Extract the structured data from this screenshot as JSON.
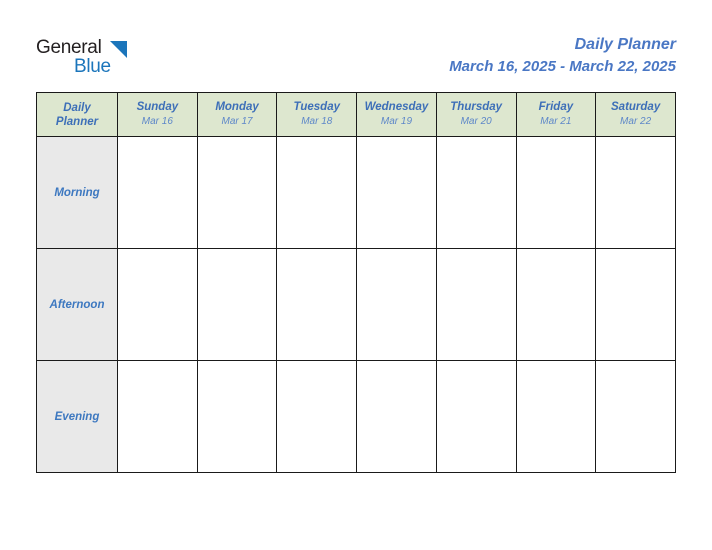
{
  "brand": {
    "name_dark": "General",
    "name_blue": "Blue",
    "triangle_color": "#1b75bb"
  },
  "header": {
    "title": "Daily Planner",
    "date_range": "March 16, 2025 - March 22, 2025",
    "title_color": "#4a77c4"
  },
  "table": {
    "corner_label_line1": "Daily",
    "corner_label_line2": "Planner",
    "header_bg": "#dde7cf",
    "period_bg": "#e9e9e9",
    "border_color": "#1a1a1a",
    "days": [
      {
        "name": "Sunday",
        "date": "Mar 16"
      },
      {
        "name": "Monday",
        "date": "Mar 17"
      },
      {
        "name": "Tuesday",
        "date": "Mar 18"
      },
      {
        "name": "Wednesday",
        "date": "Mar 19"
      },
      {
        "name": "Thursday",
        "date": "Mar 20"
      },
      {
        "name": "Friday",
        "date": "Mar 21"
      },
      {
        "name": "Saturday",
        "date": "Mar 22"
      }
    ],
    "periods": [
      {
        "label": "Morning",
        "entries": [
          "",
          "",
          "",
          "",
          "",
          "",
          ""
        ]
      },
      {
        "label": "Afternoon",
        "entries": [
          "",
          "",
          "",
          "",
          "",
          "",
          ""
        ]
      },
      {
        "label": "Evening",
        "entries": [
          "",
          "",
          "",
          "",
          "",
          "",
          ""
        ]
      }
    ]
  }
}
